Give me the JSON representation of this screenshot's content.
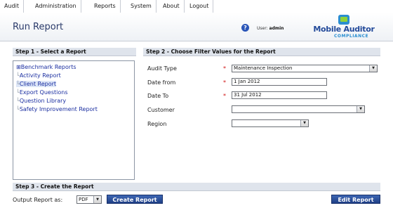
{
  "menu": {
    "items": [
      "Audit",
      "Administration",
      "Reports",
      "System",
      "About",
      "Logout"
    ]
  },
  "header": {
    "title": "Run Report",
    "user_label": "User:",
    "user_name": "admin",
    "logo_title": "Mobile Auditor",
    "logo_sub": "COMPLIANCE"
  },
  "step1": {
    "title": "Step 1 - Select a Report",
    "tree": [
      {
        "label": "Benchmark Reports",
        "expander": "⊞",
        "selected": false
      },
      {
        "label": "Activity Report",
        "selected": false
      },
      {
        "label": "Client Report",
        "selected": true
      },
      {
        "label": "Export Questions",
        "selected": false
      },
      {
        "label": "Question Library",
        "selected": false
      },
      {
        "label": "Safety Improvement Report",
        "selected": false
      }
    ]
  },
  "step2": {
    "title": "Step 2 - Choose Filter Values for the Report",
    "fields": [
      {
        "label": "Audit Type",
        "required": "*",
        "value": "Maintenance Inspection"
      },
      {
        "label": "Date from",
        "required": "*",
        "value": "1 Jan 2012"
      },
      {
        "label": "Date To",
        "required": "*",
        "value": "31 Jul 2012"
      },
      {
        "label": "Customer",
        "required": "",
        "value": ""
      },
      {
        "label": "Region",
        "required": "",
        "value": ""
      }
    ]
  },
  "step3": {
    "title": "Step 3 - Create the Report",
    "output_label": "Output Report as:",
    "output_value": "PDF",
    "create_label": "Create Report",
    "edit_label": "Edit Report"
  },
  "icons": {
    "help": "help-icon",
    "dropdown": "chevron-down-icon",
    "expander": "plus-box-icon"
  }
}
